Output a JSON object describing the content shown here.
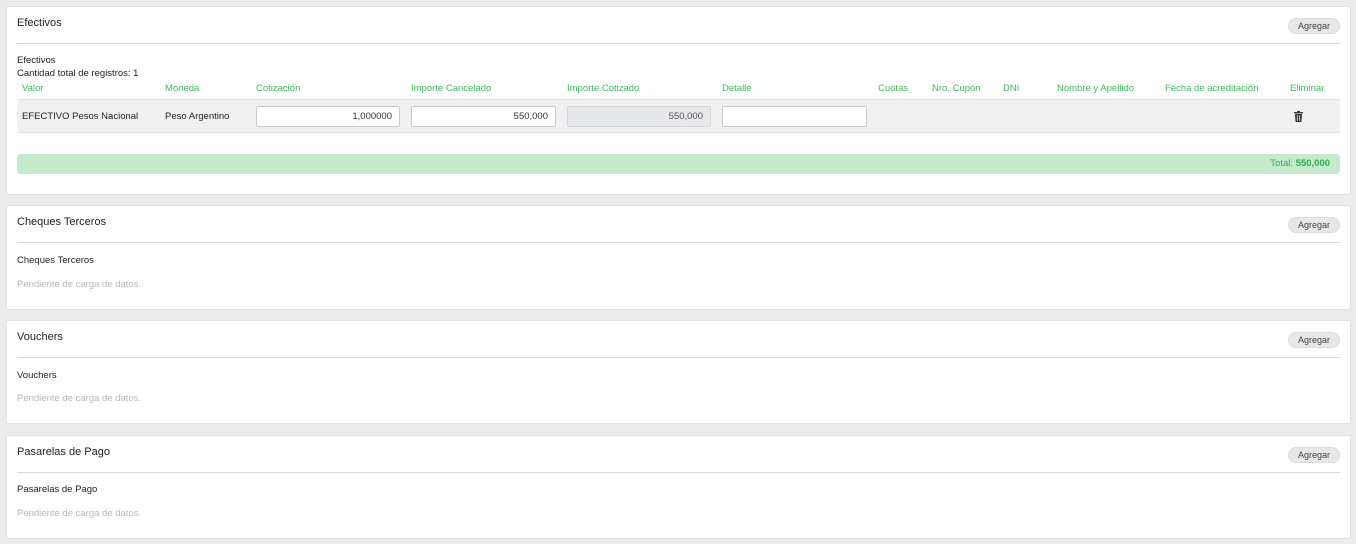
{
  "efectivos": {
    "title": "Efectivos",
    "add_label": "Agregar",
    "subtitle": "Efectivos",
    "count_text": "Cantidad total de registros: 1",
    "columns": {
      "valor": "Valor",
      "moneda": "Moneda",
      "cotizacion": "Cotización",
      "importe_cancelado": "Importe Cancelado",
      "importe_cotizado": "Importe Cotizado",
      "detalle": "Detalle",
      "cuotas": "Cuotas",
      "nro_cupon": "Nro. Cupón",
      "dni": "DNI",
      "nombre_apellido": "Nombre y Apellido",
      "fecha_acreditacion": "Fecha de acreditación",
      "eliminar": "Eliminar"
    },
    "row": {
      "valor": "EFECTIVO Pesos Nacional",
      "moneda": "Peso Argentino",
      "cotizacion": "1,000000",
      "importe_cancelado": "550,000",
      "importe_cotizado": "550,000",
      "detalle": ""
    },
    "total_label": "Total:",
    "total_value": "550,000"
  },
  "cheques_terceros": {
    "title": "Cheques Terceros",
    "add_label": "Agregar",
    "subtitle": "Cheques Terceros",
    "pending": "Pendiente de carga de datos."
  },
  "vouchers": {
    "title": "Vouchers",
    "add_label": "Agregar",
    "subtitle": "Vouchers",
    "pending": "Pendiente de carga de datos."
  },
  "pasarelas": {
    "title": "Pasarelas de Pago",
    "add_label": "Agregar",
    "subtitle": "Pasarelas de Pago",
    "pending": "Pendiente de carga de datos."
  },
  "colors": {
    "accent_green": "#3dbb5c",
    "total_bar": "#c3ebcc"
  },
  "icons": {
    "delete": "trash-icon"
  }
}
